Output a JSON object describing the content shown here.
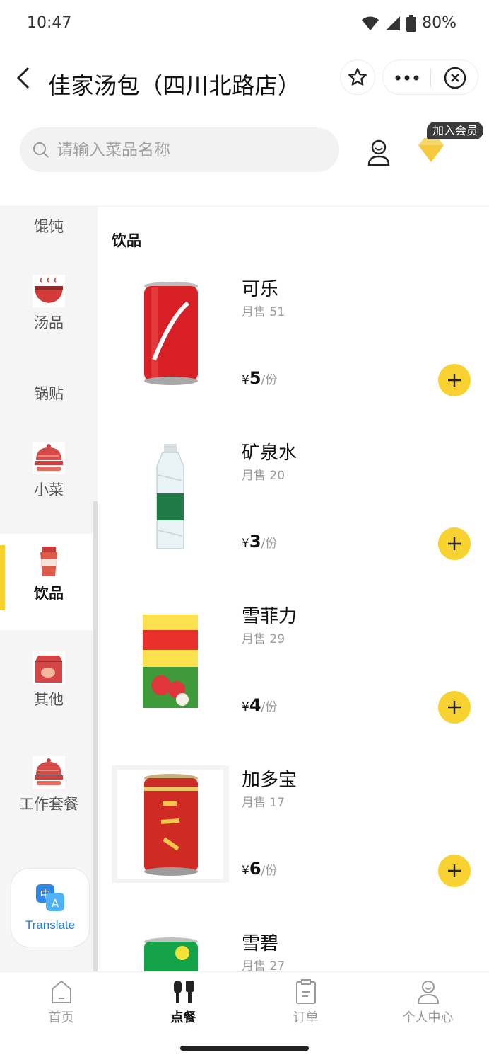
{
  "status": {
    "time": "10:47",
    "battery": "80%"
  },
  "header": {
    "title": "佳家汤包（四川北路店）"
  },
  "search": {
    "placeholder": "请输入菜品名称"
  },
  "member": {
    "badge": "加入会员"
  },
  "sidebar": {
    "items": [
      {
        "label": "馄饨",
        "icon": "none"
      },
      {
        "label": "汤品",
        "icon": "soup-bowl-icon"
      },
      {
        "label": "锅贴",
        "icon": "none"
      },
      {
        "label": "小菜",
        "icon": "covered-dish-icon"
      },
      {
        "label": "饮品",
        "icon": "drink-cup-icon",
        "active": true
      },
      {
        "label": "其他",
        "icon": "bag-icon"
      },
      {
        "label": "工作套餐",
        "icon": "covered-dish-icon"
      }
    ]
  },
  "translate": {
    "label": "Translate"
  },
  "content": {
    "section_title": "饮品",
    "dishes": [
      {
        "name": "可乐",
        "sales": "月售 51",
        "currency": "¥",
        "price": "5",
        "unit": "/份",
        "image": "cola-can"
      },
      {
        "name": "矿泉水",
        "sales": "月售 20",
        "currency": "¥",
        "price": "3",
        "unit": "/份",
        "image": "water-bottle"
      },
      {
        "name": "雪菲力",
        "sales": "月售 29",
        "currency": "¥",
        "price": "4",
        "unit": "/份",
        "image": "lychee-carton"
      },
      {
        "name": "加多宝",
        "sales": "月售 17",
        "currency": "¥",
        "price": "6",
        "unit": "/份",
        "image": "herbal-tea-can"
      },
      {
        "name": "雪碧",
        "sales": "月售 27",
        "currency": "",
        "price": "",
        "unit": "",
        "image": "sprite-can"
      }
    ]
  },
  "tabbar": {
    "tabs": [
      {
        "label": "首页",
        "icon": "home-icon"
      },
      {
        "label": "点餐",
        "icon": "utensils-icon",
        "active": true
      },
      {
        "label": "订单",
        "icon": "order-icon"
      },
      {
        "label": "个人中心",
        "icon": "profile-icon"
      }
    ]
  },
  "colors": {
    "accent": "#f8d231",
    "sidebar_bg": "#f5f5f5",
    "translate_blue": "#1e7be4"
  }
}
